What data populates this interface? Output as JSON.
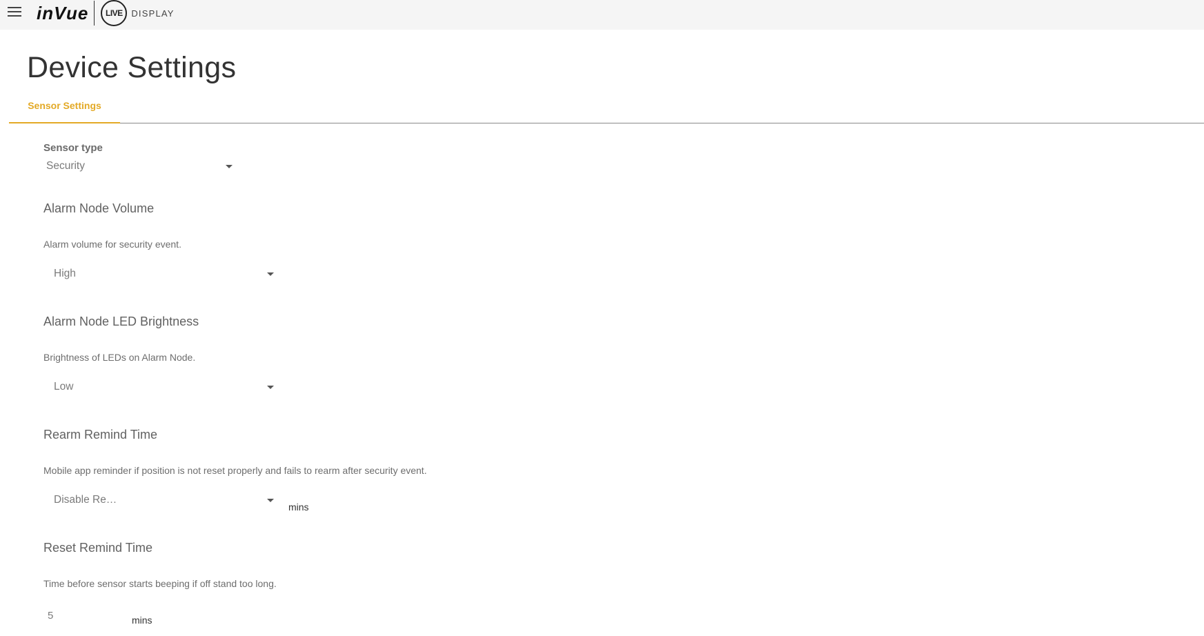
{
  "header": {
    "logo_brand": "inVue",
    "logo_live": "LIVE",
    "logo_product": "DISPLAY",
    "menu_icon": "hamburger-menu-icon"
  },
  "page": {
    "title": "Device Settings"
  },
  "tabs": [
    {
      "label": "Sensor Settings",
      "active": true
    }
  ],
  "colors": {
    "accent": "#e3a925",
    "topbar_bg": "#f5f5f5"
  },
  "settings": {
    "sensor_type": {
      "label": "Sensor type",
      "value": "Security"
    },
    "alarm_node_volume": {
      "title": "Alarm Node Volume",
      "description": "Alarm volume for security event.",
      "value": "High"
    },
    "alarm_node_led": {
      "title": "Alarm Node LED Brightness",
      "description": "Brightness of LEDs on Alarm Node.",
      "value": "Low"
    },
    "rearm_remind": {
      "title": "Rearm Remind Time",
      "description": "Mobile app reminder if position is not reset properly and fails to rearm after security event.",
      "value": "Disable Re…",
      "unit": "mins"
    },
    "reset_remind": {
      "title": "Reset Remind Time",
      "description": "Time before sensor starts beeping if off stand too long.",
      "value": "5",
      "unit": "mins"
    }
  }
}
